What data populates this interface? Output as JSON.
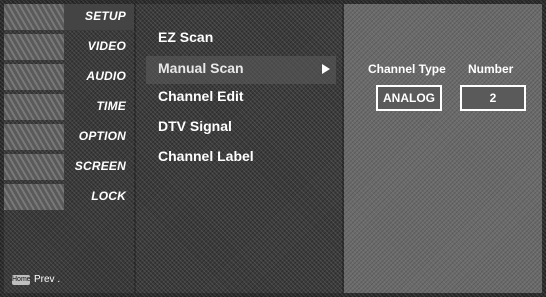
{
  "left_menu": {
    "items": [
      {
        "label": "SETUP"
      },
      {
        "label": "VIDEO"
      },
      {
        "label": "AUDIO"
      },
      {
        "label": "TIME"
      },
      {
        "label": "OPTION"
      },
      {
        "label": "SCREEN"
      },
      {
        "label": "LOCK"
      }
    ],
    "prev_key": "Home",
    "prev_label": "Prev ."
  },
  "channel_menu": {
    "items": [
      {
        "label": "EZ Scan"
      },
      {
        "label": "Manual Scan"
      },
      {
        "label": "Channel Edit"
      },
      {
        "label": "DTV Signal"
      },
      {
        "label": "Channel Label"
      }
    ],
    "selected_index": 1,
    "arrow_icon": "right-triangle-icon"
  },
  "manual_scan_panel": {
    "channel_type_header": "Channel Type",
    "number_header": "Number",
    "channel_type_value": "ANALOG",
    "number_value": "2"
  }
}
